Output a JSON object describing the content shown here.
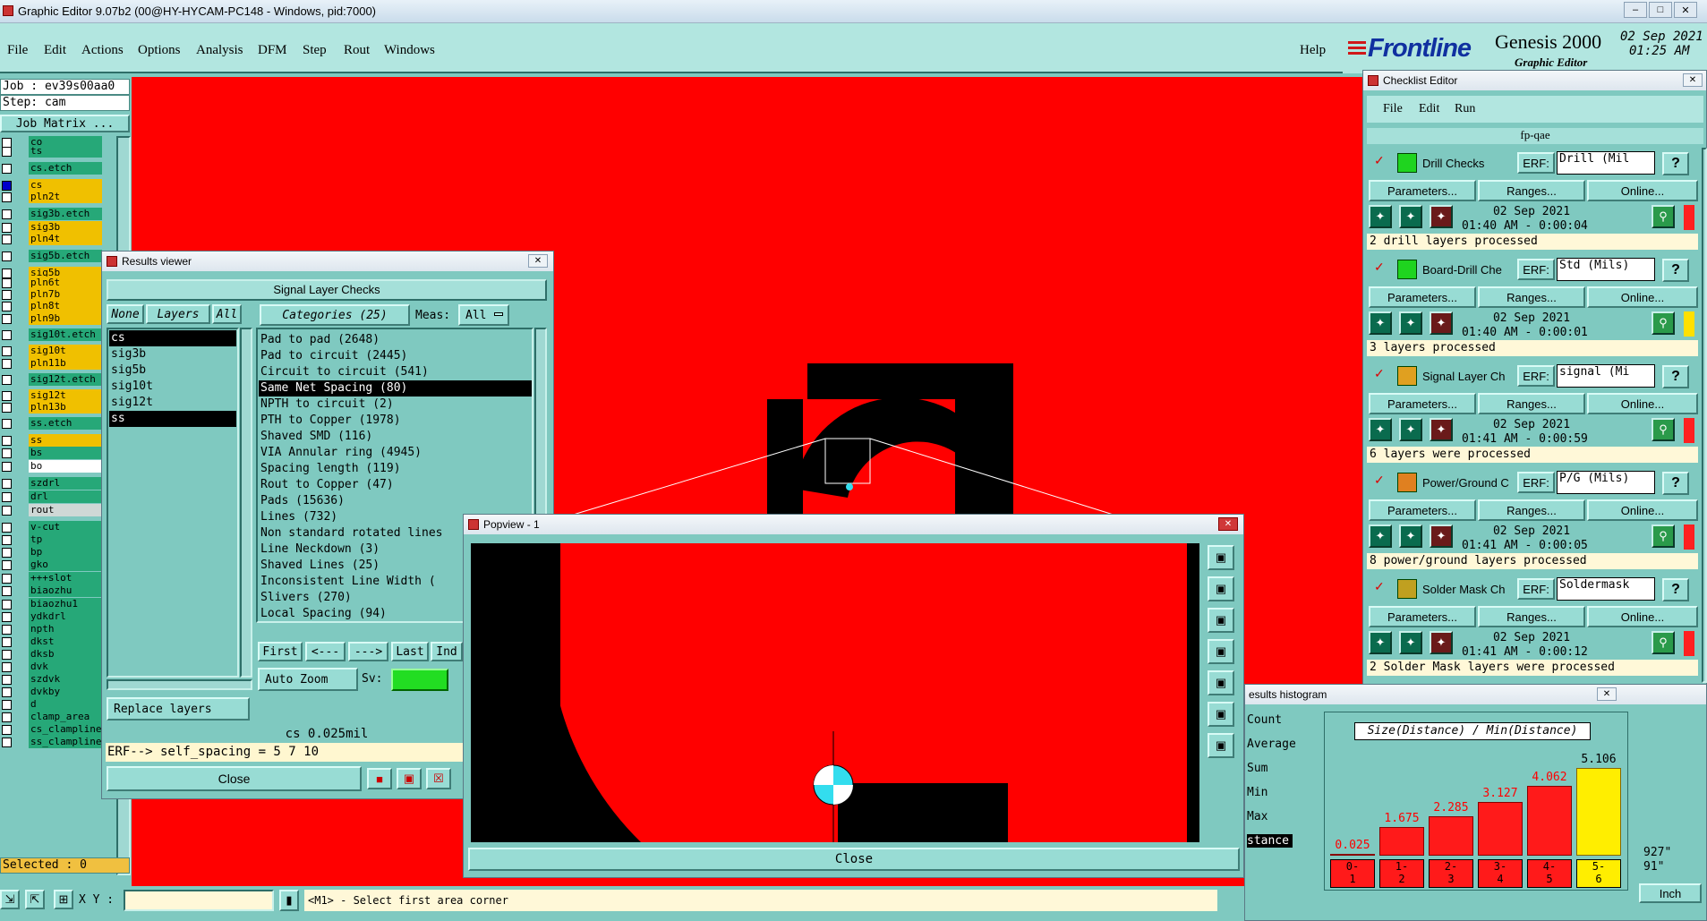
{
  "app": {
    "title": "Graphic Editor 9.07b2 (00@HY-HYCAM-PC148 - Windows, pid:7000)",
    "date": "02 Sep 2021",
    "time": "01:25 AM",
    "brand": "Frontline",
    "product": "Genesis 2000",
    "product_sub": "Graphic Editor"
  },
  "menu": [
    "File",
    "Edit",
    "Actions",
    "Options",
    "Analysis",
    "DFM",
    "Step",
    "Rout",
    "Windows"
  ],
  "help": "Help",
  "left": {
    "job": "Job : ev39s00aa0",
    "step": "Step: cam",
    "job_matrix": "Job Matrix ...",
    "selected": "Selected : 0"
  },
  "layers": [
    {
      "name": "co",
      "color": "#26a878",
      "on": false
    },
    {
      "name": "ts",
      "color": "#26a878",
      "on": false
    },
    {
      "name": "cs.etch",
      "color": "#26a878",
      "on": false
    },
    {
      "name": "cs",
      "color": "#f0c000",
      "on": true
    },
    {
      "name": "pln2t",
      "color": "#f0c000",
      "on": false
    },
    {
      "name": "sig3b.etch",
      "color": "#26a878",
      "on": false
    },
    {
      "name": "sig3b",
      "color": "#f0c000",
      "on": false
    },
    {
      "name": "pln4t",
      "color": "#f0c000",
      "on": false
    },
    {
      "name": "sig5b.etch",
      "color": "#26a878",
      "on": false
    },
    {
      "name": "sig5b",
      "color": "#f0c000",
      "on": false
    },
    {
      "name": "pln6t",
      "color": "#f0c000",
      "on": false
    },
    {
      "name": "pln7b",
      "color": "#f0c000",
      "on": false
    },
    {
      "name": "pln8t",
      "color": "#f0c000",
      "on": false
    },
    {
      "name": "pln9b",
      "color": "#f0c000",
      "on": false
    },
    {
      "name": "sig10t.etch",
      "color": "#26a878",
      "on": false
    },
    {
      "name": "sig10t",
      "color": "#f0c000",
      "on": false
    },
    {
      "name": "pln11b",
      "color": "#f0c000",
      "on": false
    },
    {
      "name": "sig12t.etch",
      "color": "#26a878",
      "on": false
    },
    {
      "name": "sig12t",
      "color": "#f0c000",
      "on": false
    },
    {
      "name": "pln13b",
      "color": "#f0c000",
      "on": false
    },
    {
      "name": "ss.etch",
      "color": "#26a878",
      "on": false
    },
    {
      "name": "ss",
      "color": "#f0c000",
      "on": false
    },
    {
      "name": "bs",
      "color": "#26a878",
      "on": false
    },
    {
      "name": "bo",
      "color": "#ffffff",
      "on": false
    },
    {
      "name": "szdrl",
      "color": "#26a878",
      "on": false
    },
    {
      "name": "drl",
      "color": "#26a878",
      "on": false
    },
    {
      "name": "rout",
      "color": "#cfd8d6",
      "on": false
    },
    {
      "name": "v-cut",
      "color": "#26a878",
      "on": false
    },
    {
      "name": "tp",
      "color": "#26a878",
      "on": false
    },
    {
      "name": "bp",
      "color": "#26a878",
      "on": false
    },
    {
      "name": "gko",
      "color": "#26a878",
      "on": false
    },
    {
      "name": "+++slot",
      "color": "#26a878",
      "on": false
    },
    {
      "name": "biaozhu",
      "color": "#26a878",
      "on": false
    },
    {
      "name": "biaozhu1",
      "color": "#26a878",
      "on": false
    },
    {
      "name": "ydkdrl",
      "color": "#26a878",
      "on": false
    },
    {
      "name": "npth",
      "color": "#26a878",
      "on": false
    },
    {
      "name": "dkst",
      "color": "#26a878",
      "on": false
    },
    {
      "name": "dksb",
      "color": "#26a878",
      "on": false
    },
    {
      "name": "dvk",
      "color": "#26a878",
      "on": false
    },
    {
      "name": "szdvk",
      "color": "#26a878",
      "on": false
    },
    {
      "name": "dvkby",
      "color": "#26a878",
      "on": false
    },
    {
      "name": "d",
      "color": "#26a878",
      "on": false
    },
    {
      "name": "clamp_area",
      "color": "#26a878",
      "on": false
    },
    {
      "name": "cs_clampline",
      "color": "#26a878",
      "on": false
    },
    {
      "name": "ss_clampline",
      "color": "#26a878",
      "on": false
    }
  ],
  "results": {
    "title": "Results viewer",
    "header": "Signal Layer Checks",
    "none": "None",
    "layers": "Layers",
    "all": "All",
    "categories_label": "Categories (25)",
    "meas_label": "Meas:",
    "meas_value": "All",
    "layer_list": [
      "cs",
      "sig3b",
      "sig5b",
      "sig10t",
      "sig12t",
      "ss"
    ],
    "categories": [
      "Pad to pad (2648)",
      "Pad to circuit (2445)",
      "Circuit to circuit (541)",
      "Same Net Spacing (80)",
      "NPTH to circuit (2)",
      "PTH to Copper (1978)",
      "Shaved SMD (116)",
      "VIA Annular ring (4945)",
      "Spacing length (119)",
      "Rout to Copper (47)",
      "Pads (15636)",
      "Lines (732)",
      "Non standard rotated lines",
      "Line Neckdown (3)",
      "Shaved Lines (25)",
      "Inconsistent Line Width (",
      "Slivers (270)",
      "Local Spacing (94)"
    ],
    "first": "First",
    "prev": "<---",
    "next": "--->",
    "last": "Last",
    "ind": "Ind",
    "auto_zoom": "Auto Zoom",
    "sv": "Sv:",
    "replace_layers": "Replace layers",
    "measure": "cs 0.025mil",
    "erf": "ERF--> self_spacing = 5 7 10",
    "close": "Close"
  },
  "popview": {
    "title": "Popview - 1",
    "close": "Close"
  },
  "checklist": {
    "title": "Checklist Editor",
    "menu": [
      "File",
      "Edit",
      "Run"
    ],
    "name": "fp-qae",
    "erf_label": "ERF:",
    "parameters": "Parameters...",
    "ranges": "Ranges...",
    "online": "Online...",
    "items": [
      {
        "name": "Drill Checks",
        "erf": "Drill (Mil",
        "date": "02 Sep 2021",
        "time": "01:40 AM - 0:00:04",
        "status": "2 drill layers processed",
        "flag": "#ff2020",
        "icon": "#1fd41f"
      },
      {
        "name": "Board-Drill Che",
        "erf": "Std (Mils)",
        "date": "02 Sep 2021",
        "time": "01:40 AM - 0:00:01",
        "status": "3 layers processed",
        "flag": "#ffe000",
        "icon": "#1fd41f"
      },
      {
        "name": "Signal Layer Ch",
        "erf": "signal (Mi",
        "date": "02 Sep 2021",
        "time": "01:41 AM - 0:00:59",
        "status": "6 layers were processed",
        "flag": "#ff2020",
        "icon": "#e0a020"
      },
      {
        "name": "Power/Ground C",
        "erf": "P/G (Mils)",
        "date": "02 Sep 2021",
        "time": "01:41 AM - 0:00:05",
        "status": "8 power/ground layers processed",
        "flag": "#ff2020",
        "icon": "#e08020"
      },
      {
        "name": "Solder Mask Ch",
        "erf": "Soldermask",
        "date": "02 Sep 2021",
        "time": "01:41 AM - 0:00:12",
        "status": "2 Solder Mask layers were processed",
        "flag": "#ff2020",
        "icon": "#c0a020"
      }
    ]
  },
  "histogram": {
    "title": "esults histogram",
    "header": "Size(Distance) / Min(Distance)",
    "stats": [
      "Count",
      "Average",
      "Sum",
      "Min",
      "Max",
      "stance"
    ],
    "values": [
      0.025,
      1.675,
      2.285,
      3.127,
      4.062,
      5.106
    ],
    "value_labels": [
      "0.025",
      "1.675",
      "2.285",
      "3.127",
      "4.062",
      "5.106"
    ],
    "bins": [
      "0-\n1",
      "1-\n2",
      "2-\n3",
      "3-\n4",
      "4-\n5",
      "5-\n6"
    ],
    "side": [
      "927\"",
      "91\""
    ],
    "units": "Inch"
  },
  "statusbar": {
    "xy_label": "X Y :",
    "prompt": "<M1> - Select first area corner"
  }
}
